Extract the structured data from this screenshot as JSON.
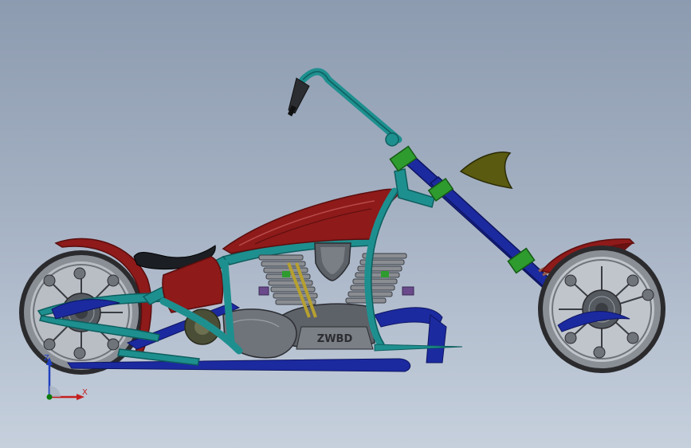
{
  "viewport": {
    "title": "",
    "background_top": "#8d9bb0",
    "background_bottom": "#c6d0dd"
  },
  "model": {
    "engine_logo_text": "ZWBD",
    "colors": {
      "frame": "#1e8f8f",
      "frame_dark": "#0e5e5e",
      "tank": "#8e1a1a",
      "tank_dark": "#5a0e0e",
      "lower_rails": "#1c2aa0",
      "engine_gray": "#6f737a",
      "engine_dark": "#3a3d42",
      "fins": "#8a8d92",
      "seat": "#1b1e22",
      "wheel_rim": "#8a8f96",
      "tire": "#2b2b2e",
      "green_clamp": "#2e9b2e",
      "spring": "#9a5b4a",
      "purple_part": "#6a4a8a",
      "headlight": "#5a5a10"
    }
  },
  "triad": {
    "x_label": "X",
    "z_label": "Z",
    "x_color": "#c42020",
    "z_color": "#1f3fbf",
    "origin_color": "#0a7a0a"
  }
}
